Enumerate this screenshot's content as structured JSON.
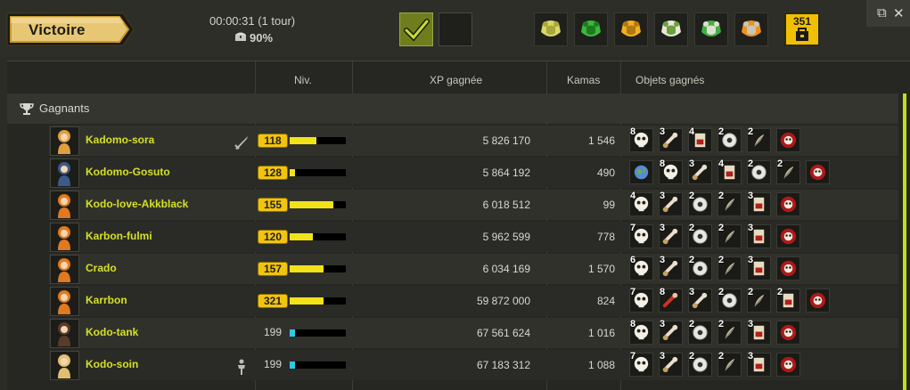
{
  "result": {
    "label": "Victoire"
  },
  "fight": {
    "time": "00:00:31 (1 tour)",
    "loot_pct": "90%"
  },
  "total_items": "351",
  "team_icons": [
    "armor-yellow-icon",
    "armor-green-icon",
    "armor-gold-icon",
    "armor-white-green-icon",
    "armor-green-white-icon",
    "armor-orange-icon"
  ],
  "columns": {
    "level": "Niv.",
    "xp": "XP gagnée",
    "kamas": "Kamas",
    "items": "Objets gagnés"
  },
  "group": {
    "label": "Gagnants"
  },
  "colors": {
    "name": "#d4e028",
    "level_fill": "#f2e21a",
    "level_fill_max": "#30c8e6",
    "scroll": "#bfe01a"
  },
  "players": [
    {
      "name": "Kadomo-sora",
      "role": "sword-icon",
      "level": "118",
      "level_badge": true,
      "progress": 0.48,
      "xp": "5 826 170",
      "kamas": "1 546",
      "items": [
        {
          "q": "8",
          "i": "skull-icon"
        },
        {
          "q": "3",
          "i": "bone-icon"
        },
        {
          "q": "4",
          "i": "scroll-icon"
        },
        {
          "q": "2",
          "i": "eye-icon"
        },
        {
          "q": "2",
          "i": "feather-icon"
        },
        {
          "q": "",
          "i": "red-skull-icon"
        }
      ]
    },
    {
      "name": "Kodomo-Gosuto",
      "role": "",
      "level": "128",
      "level_badge": true,
      "progress": 0.1,
      "xp": "5 864 192",
      "kamas": "490",
      "items": [
        {
          "q": "",
          "i": "globe-icon"
        },
        {
          "q": "8",
          "i": "skull-icon"
        },
        {
          "q": "3",
          "i": "bone-icon"
        },
        {
          "q": "4",
          "i": "scroll-icon"
        },
        {
          "q": "2",
          "i": "eye-icon"
        },
        {
          "q": "2",
          "i": "feather-icon"
        },
        {
          "q": "",
          "i": "red-skull-icon"
        }
      ]
    },
    {
      "name": "Kodo-love-Akkblack",
      "role": "",
      "level": "155",
      "level_badge": true,
      "progress": 0.78,
      "xp": "6 018 512",
      "kamas": "99",
      "items": [
        {
          "q": "4",
          "i": "skull-icon"
        },
        {
          "q": "3",
          "i": "bone-icon"
        },
        {
          "q": "2",
          "i": "eye-icon"
        },
        {
          "q": "2",
          "i": "feather-icon"
        },
        {
          "q": "3",
          "i": "scroll-icon"
        },
        {
          "q": "",
          "i": "red-skull-icon"
        }
      ]
    },
    {
      "name": "Karbon-fulmi",
      "role": "",
      "level": "120",
      "level_badge": true,
      "progress": 0.42,
      "xp": "5 962 599",
      "kamas": "778",
      "items": [
        {
          "q": "7",
          "i": "skull-icon"
        },
        {
          "q": "3",
          "i": "bone-icon"
        },
        {
          "q": "2",
          "i": "eye-icon"
        },
        {
          "q": "2",
          "i": "feather-icon"
        },
        {
          "q": "3",
          "i": "scroll-icon"
        },
        {
          "q": "",
          "i": "red-skull-icon"
        }
      ]
    },
    {
      "name": "Crado",
      "role": "",
      "level": "157",
      "level_badge": true,
      "progress": 0.6,
      "xp": "6 034 169",
      "kamas": "1 570",
      "items": [
        {
          "q": "6",
          "i": "skull-icon"
        },
        {
          "q": "3",
          "i": "bone-icon"
        },
        {
          "q": "2",
          "i": "eye-icon"
        },
        {
          "q": "2",
          "i": "feather-icon"
        },
        {
          "q": "3",
          "i": "scroll-icon"
        },
        {
          "q": "",
          "i": "red-skull-icon"
        }
      ]
    },
    {
      "name": "Karrbon",
      "role": "",
      "level": "321",
      "level_badge": true,
      "progress": 0.6,
      "xp": "59 872 000",
      "kamas": "824",
      "items": [
        {
          "q": "7",
          "i": "skull-icon"
        },
        {
          "q": "8",
          "i": "red-bone-icon"
        },
        {
          "q": "3",
          "i": "bone-icon"
        },
        {
          "q": "2",
          "i": "eye-icon"
        },
        {
          "q": "2",
          "i": "feather-icon"
        },
        {
          "q": "2",
          "i": "scroll-icon"
        },
        {
          "q": "",
          "i": "red-skull-icon"
        }
      ]
    },
    {
      "name": "Kodo-tank",
      "role": "",
      "level": "199",
      "level_badge": false,
      "progress": 0.1,
      "xp": "67 561 624",
      "kamas": "1 016",
      "items": [
        {
          "q": "8",
          "i": "skull-icon"
        },
        {
          "q": "3",
          "i": "bone-icon"
        },
        {
          "q": "2",
          "i": "eye-icon"
        },
        {
          "q": "2",
          "i": "feather-icon"
        },
        {
          "q": "3",
          "i": "scroll-icon"
        },
        {
          "q": "",
          "i": "red-skull-icon"
        }
      ]
    },
    {
      "name": "Kodo-soin",
      "role": "person-icon",
      "level": "199",
      "level_badge": false,
      "progress": 0.1,
      "xp": "67 183 312",
      "kamas": "1 088",
      "items": [
        {
          "q": "7",
          "i": "skull-icon"
        },
        {
          "q": "3",
          "i": "bone-icon"
        },
        {
          "q": "2",
          "i": "eye-icon"
        },
        {
          "q": "2",
          "i": "feather-icon"
        },
        {
          "q": "3",
          "i": "scroll-icon"
        },
        {
          "q": "",
          "i": "red-skull-icon"
        }
      ]
    }
  ]
}
